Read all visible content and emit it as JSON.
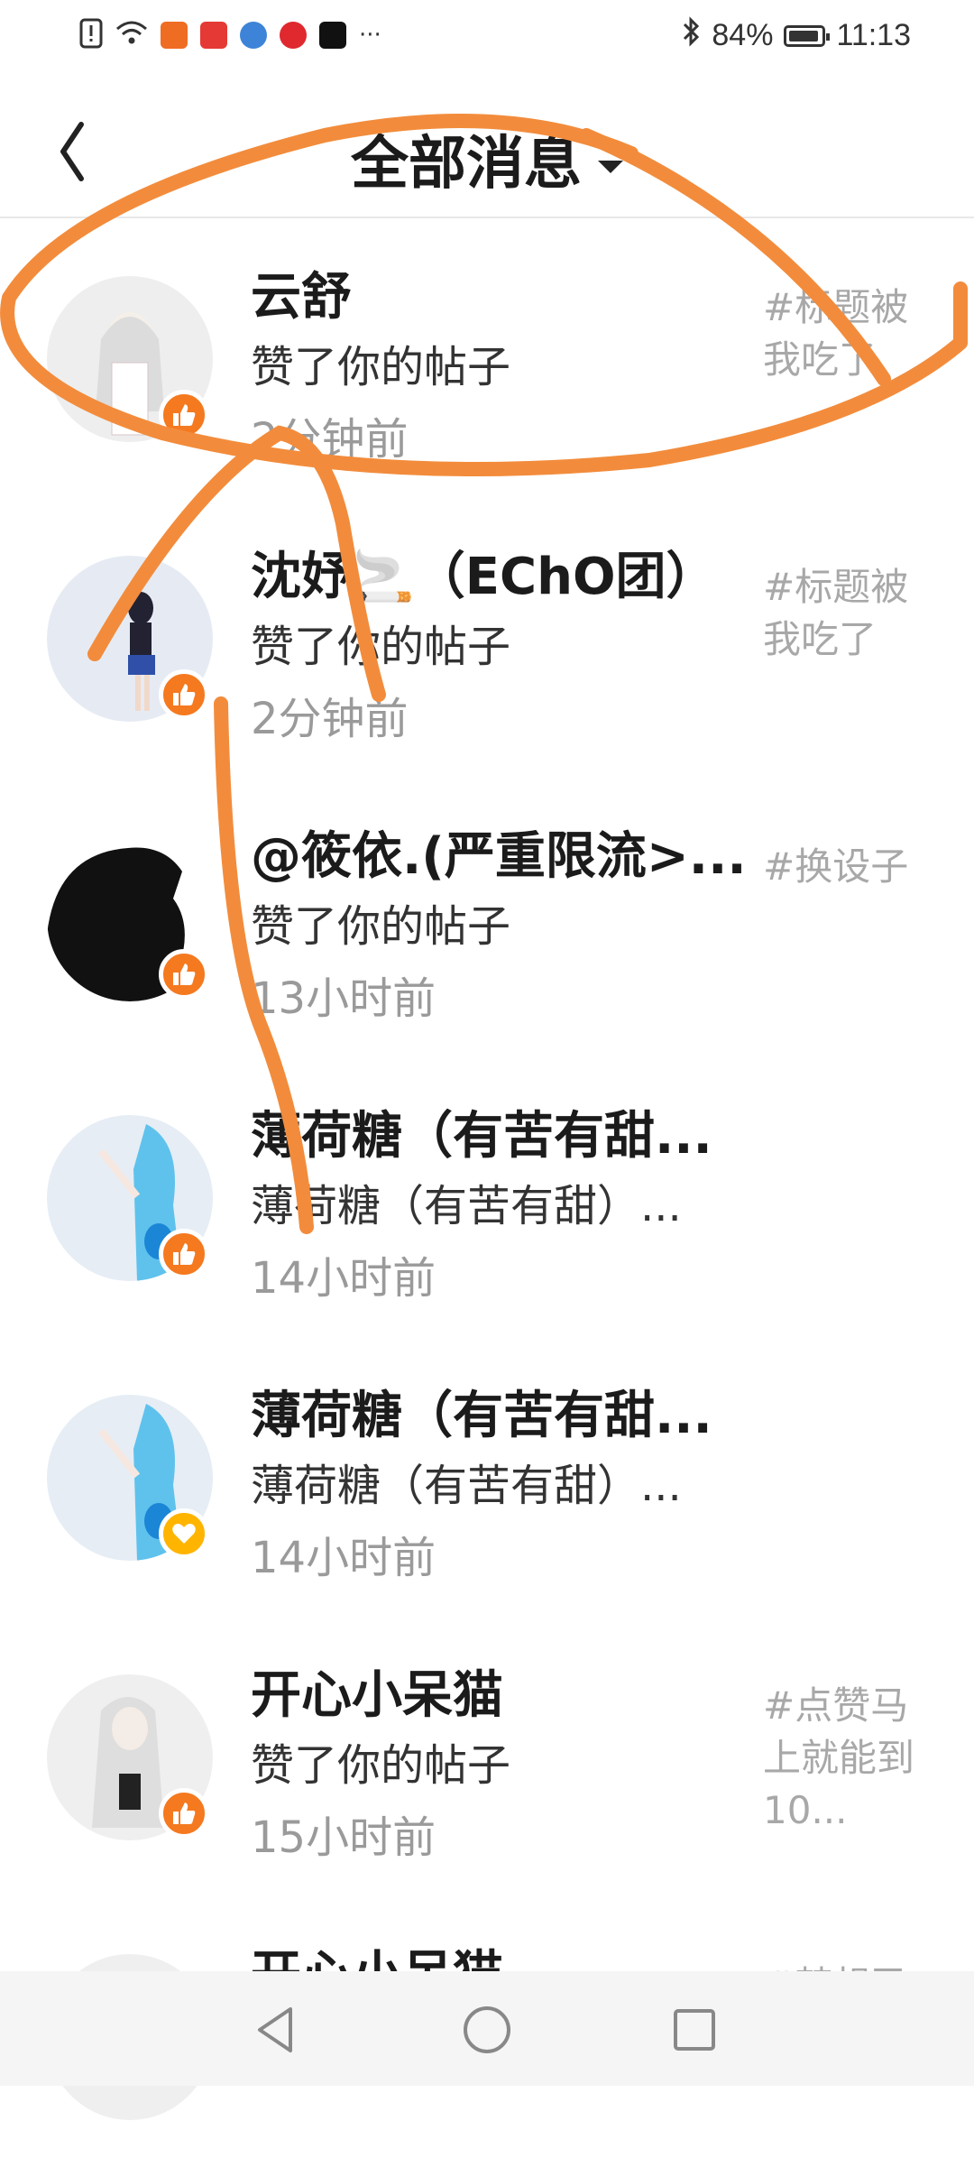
{
  "status_bar": {
    "battery": "84%",
    "time": "11:13",
    "icons": [
      "alert-icon",
      "wifi-icon",
      "app-icon",
      "huawei-icon",
      "browser-icon",
      "video-icon",
      "tiktok-icon",
      "more-icon",
      "bluetooth-icon",
      "battery-icon"
    ],
    "more": "···"
  },
  "header": {
    "title": "全部消息",
    "back_icon": "chevron-left-icon",
    "dropdown_icon": "caret-down-icon"
  },
  "messages": [
    {
      "name": "云舒",
      "action": "赞了你的帖子",
      "time": "2分钟前",
      "topic": "#标题被我吃了",
      "badge": "thumbs-up-icon",
      "avatar_color": "#eeeeee"
    },
    {
      "name": "沈妤🚬（EChO团）",
      "action": "赞了你的帖子",
      "time": "2分钟前",
      "topic": "#标题被我吃了",
      "badge": "thumbs-up-icon",
      "avatar_color": "#e6ebf3"
    },
    {
      "name": "@筱依.(严重限流>...",
      "action": "赞了你的帖子",
      "time": "13小时前",
      "topic": "#换设子",
      "badge": "thumbs-up-icon",
      "avatar_color": "#111111"
    },
    {
      "name": "薄荷糖（有苦有甜...",
      "action": "薄荷糖（有苦有甜）...",
      "time": "14小时前",
      "topic": "",
      "badge": "thumbs-up-icon",
      "avatar_color": "#e6edf5"
    },
    {
      "name": "薄荷糖（有苦有甜...",
      "action": "薄荷糖（有苦有甜）...",
      "time": "14小时前",
      "topic": "",
      "badge": "heart-icon",
      "avatar_color": "#e6edf5"
    },
    {
      "name": "开心小呆猫",
      "action": "赞了你的帖子",
      "time": "15小时前",
      "topic": "#点赞马上就能到10...",
      "badge": "thumbs-up-icon",
      "avatar_color": "#efefef"
    },
    {
      "name": "开心小呆猫",
      "action": "",
      "time": "",
      "topic": "#梦想已",
      "badge": "thumbs-up-icon",
      "avatar_color": "#efefef"
    }
  ],
  "colors": {
    "accent_orange": "#f5791f",
    "heart_yellow": "#ffb400",
    "annotation_orange": "#f28c3c"
  },
  "nav_bar": {
    "back": "triangle-back-icon",
    "home": "circle-home-icon",
    "recents": "square-recents-icon"
  }
}
